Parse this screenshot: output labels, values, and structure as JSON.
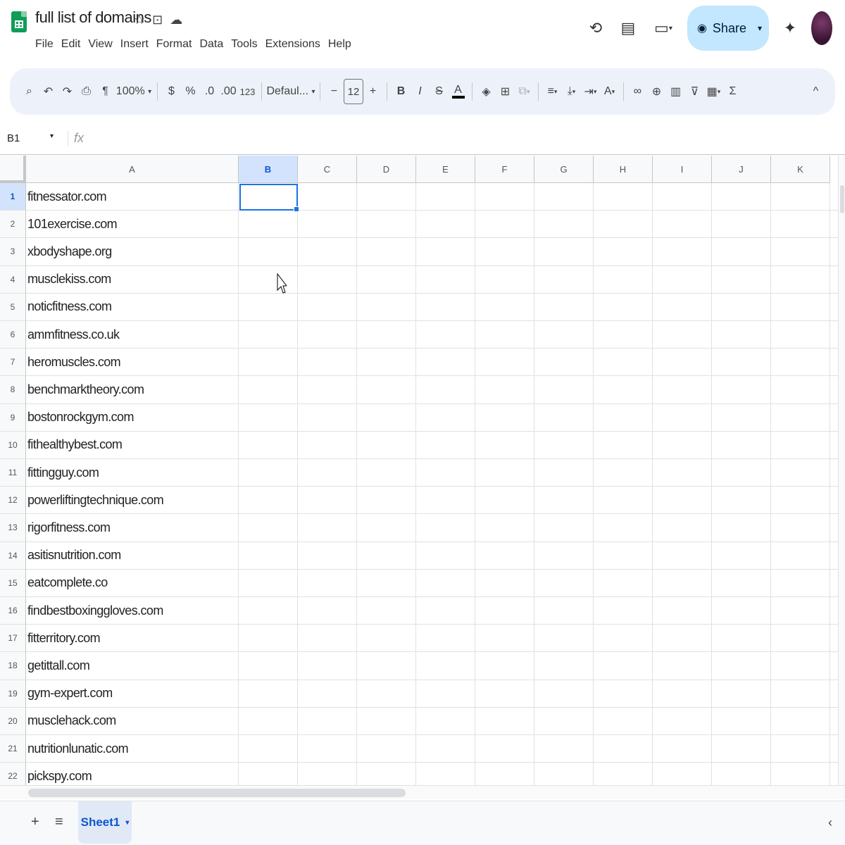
{
  "doc": {
    "title": "full list of domains"
  },
  "menu": [
    "File",
    "Edit",
    "View",
    "Insert",
    "Format",
    "Data",
    "Tools",
    "Extensions",
    "Help"
  ],
  "header_icons": [
    "star-icon",
    "move-to-folder-icon",
    "cloud-status-icon"
  ],
  "header_right": {
    "history_icon": "history-icon",
    "comments_icon": "comments-icon",
    "meet_icon": "meet-icon",
    "share_label": "Share",
    "gemini_icon": "sparkle-icon"
  },
  "toolbar": {
    "zoom": "100%",
    "currency": "$",
    "percent": "%",
    "decrease_decimal": ".0",
    "increase_decimal": ".00",
    "more_formats": "123",
    "font": "Defaul...",
    "font_size": "12",
    "bold": "B",
    "italic": "I",
    "text_color": "A",
    "text_color_swatch": "#000000",
    "sum": "Σ"
  },
  "formula_bar": {
    "name_box": "B1",
    "fx": "fx",
    "value": ""
  },
  "columns": [
    "A",
    "B",
    "C",
    "D",
    "E",
    "F",
    "G",
    "H",
    "I",
    "J",
    "K"
  ],
  "selected_cell": {
    "column": "B",
    "row": 1
  },
  "rows": [
    {
      "n": "1",
      "a": "fitnessator.com"
    },
    {
      "n": "2",
      "a": "101exercise.com"
    },
    {
      "n": "3",
      "a": "xbodyshape.org"
    },
    {
      "n": "4",
      "a": "musclekiss.com"
    },
    {
      "n": "5",
      "a": "noticfitness.com"
    },
    {
      "n": "6",
      "a": "ammfitness.co.uk"
    },
    {
      "n": "7",
      "a": "heromuscles.com"
    },
    {
      "n": "8",
      "a": "benchmarktheory.com"
    },
    {
      "n": "9",
      "a": "bostonrockgym.com"
    },
    {
      "n": "10",
      "a": "fithealthybest.com"
    },
    {
      "n": "11",
      "a": "fittingguy.com"
    },
    {
      "n": "12",
      "a": "powerliftingtechnique.com"
    },
    {
      "n": "13",
      "a": "rigorfitness.com"
    },
    {
      "n": "14",
      "a": "asitisnutrition.com"
    },
    {
      "n": "15",
      "a": "eatcomplete.co"
    },
    {
      "n": "16",
      "a": "findbestboxinggloves.com"
    },
    {
      "n": "17",
      "a": "fitterritory.com"
    },
    {
      "n": "18",
      "a": "getittall.com"
    },
    {
      "n": "19",
      "a": "gym-expert.com"
    },
    {
      "n": "20",
      "a": "musclehack.com"
    },
    {
      "n": "21",
      "a": "nutritionlunatic.com"
    },
    {
      "n": "22",
      "a": "pickspy.com"
    }
  ],
  "bottom": {
    "add_sheet": "+",
    "all_sheets": "≡",
    "sheet_tab": "Sheet1"
  }
}
